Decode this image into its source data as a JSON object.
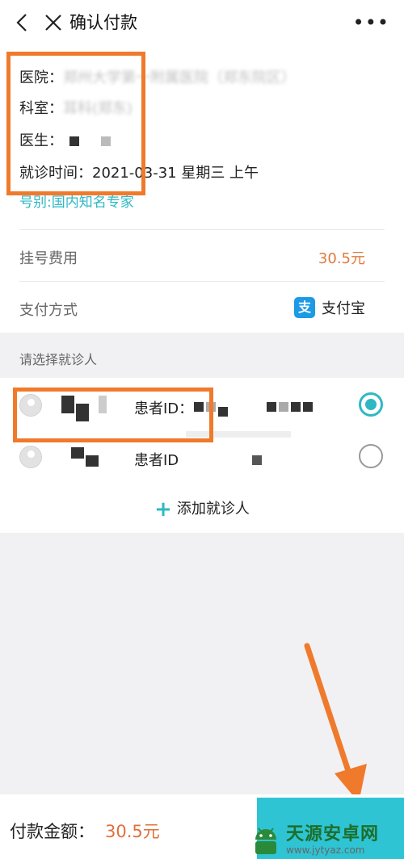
{
  "header": {
    "title": "确认付款",
    "more": "•••"
  },
  "visit": {
    "hospital_label": "医院：",
    "hospital_value": "郑州大学第一附属医院（郑东院区）",
    "department_label": "科室：",
    "department_value": "耳科(郑东)",
    "doctor_label": "医生：",
    "time_label": "就诊时间：",
    "time_value": "2021-03-31 星期三 上午",
    "registration_type": "号别:国内知名专家"
  },
  "fee": {
    "label": "挂号费用",
    "value": "30.5元"
  },
  "payment": {
    "label": "支付方式",
    "method": "支付宝",
    "icon": "alipay-icon"
  },
  "patients": {
    "section_title": "请选择就诊人",
    "items": [
      {
        "id_label": "患者ID：",
        "selected": true
      },
      {
        "id_label": "患者ID",
        "selected": false
      }
    ],
    "add_label": "添加就诊人"
  },
  "footer": {
    "amount_label": "付款金额：",
    "amount_value": "30.5元"
  },
  "watermark": {
    "name": "天源安卓网",
    "url": "www.jytyaz.com"
  },
  "colors": {
    "accent": "#2fb8c4",
    "price": "#e07a3b",
    "highlight_box": "#f07a2b",
    "pay_button": "#2ec4d3"
  }
}
